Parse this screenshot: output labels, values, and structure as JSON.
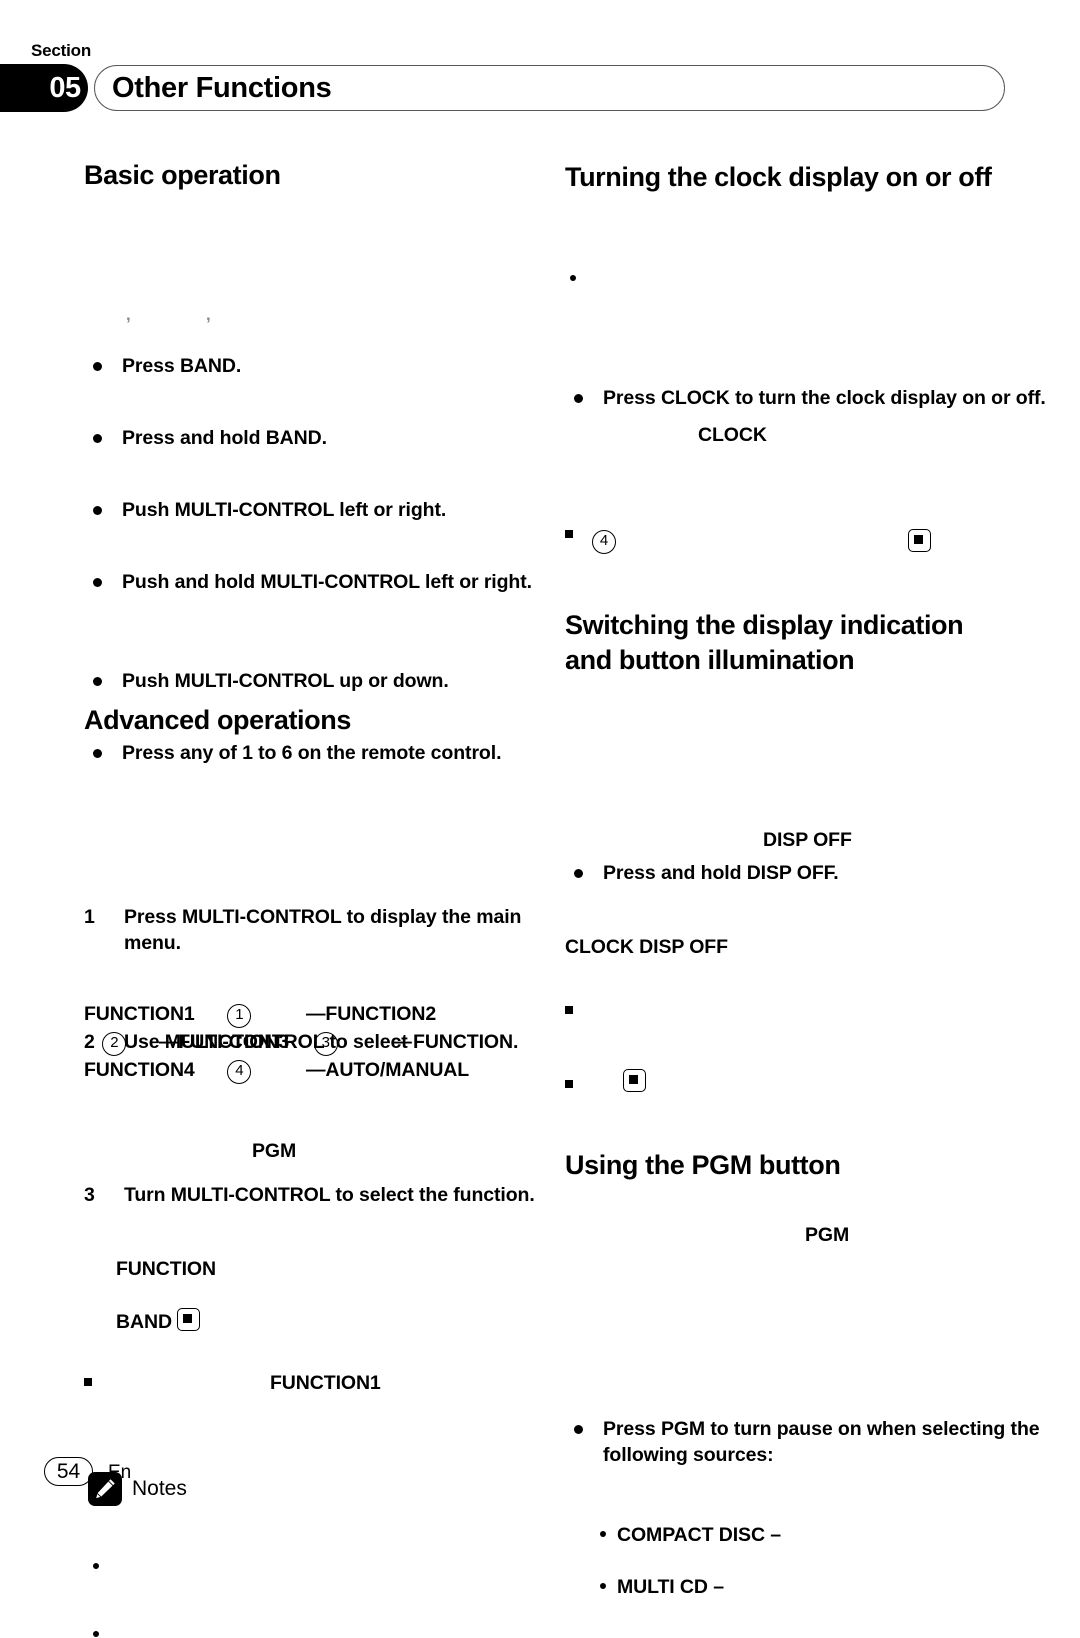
{
  "page": {
    "section_word": "Section",
    "section_number": "05",
    "title": "Other Functions",
    "page_number": "54",
    "language_code": "En"
  },
  "left_column": {
    "heading_basic": "Basic operation",
    "ghost_marks": [
      ",",
      ","
    ],
    "basic_bullets": [
      "Press BAND.",
      "Press and hold BAND.",
      "Push MULTI-CONTROL left or right.",
      "Push and hold MULTI-CONTROL left or right.",
      "Push MULTI-CONTROL up or down.",
      "Press any of 1 to 6 on the remote control."
    ],
    "heading_advanced": "Advanced operations",
    "steps": [
      {
        "num": "1",
        "text": "Press MULTI-CONTROL to display the main menu."
      },
      {
        "num": "2",
        "text": "Use MULTI-CONTROL to select FUNCTION."
      },
      {
        "num": "3",
        "text": "Turn MULTI-CONTROL to select the function."
      }
    ],
    "function_chain": {
      "line1_a": "FUNCTION1",
      "line1_circ": "1",
      "line1_dash": "—FUNCTION2",
      "line2_circ": "2",
      "line2_dash": "—FUNCTION3",
      "line2_circ2": "3",
      "line2_dash2": "—",
      "line3_a": "FUNCTION4",
      "line3_circ": "4",
      "line3_dash": "—AUTO/MANUAL"
    },
    "sq_note": {
      "term": "FUNCTION1",
      "term2": "PGM"
    },
    "notes": {
      "icon": "pencil-icon",
      "label": "Notes",
      "items": [
        {
          "term": "FUNCTION"
        },
        {
          "term": "BAND",
          "glyph": "stop-button-icon"
        }
      ]
    }
  },
  "right_column": {
    "heading_clock": "Turning the clock display on or off",
    "clock_bullet": "Press CLOCK to turn the clock display on or off.",
    "clock_term": "CLOCK",
    "clock_circnum": "4",
    "clock_glyph": "stop-button-icon",
    "heading_switching": "Switching the display indication and button illumination",
    "disp_bullet": "Press and hold DISP OFF.",
    "disp_term": "DISP OFF",
    "clock_disp_off_term": "CLOCK DISP OFF",
    "switching_glyph": "stop-button-icon",
    "heading_pgm": "Using the PGM button",
    "pgm_term": "PGM",
    "pgm_bullet": "Press PGM to turn pause on when selecting the following sources:",
    "pgm_sources": [
      "COMPACT DISC –",
      "MULTI CD –"
    ]
  }
}
